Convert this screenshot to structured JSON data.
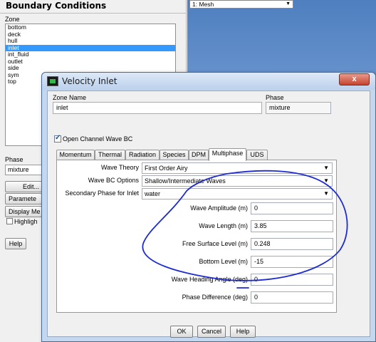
{
  "panel": {
    "title": "Boundary Conditions",
    "zone_label": "Zone",
    "zones": [
      "bottom",
      "deck",
      "hull",
      "inlet",
      "int_fluid",
      "outlet",
      "side",
      "sym",
      "top"
    ],
    "selected_zone_index": 3,
    "phase_label": "Phase",
    "phase_value": "mixture",
    "edit_button": "Edit...",
    "parameters_button": "Paramete",
    "display_mesh_button": "Display Me",
    "highlight_label": "Highligh",
    "help_button": "Help"
  },
  "mesh": {
    "combo_value": "1: Mesh",
    "background_color": "#7da5db"
  },
  "dialog": {
    "title": "Velocity Inlet",
    "close_glyph": "x",
    "zone_name_label": "Zone Name",
    "zone_name_value": "inlet",
    "phase_label": "Phase",
    "phase_value": "mixture",
    "open_channel_label": "Open Channel Wave BC",
    "open_channel_checked": true,
    "tabs": [
      "Momentum",
      "Thermal",
      "Radiation",
      "Species",
      "DPM",
      "Multiphase",
      "UDS"
    ],
    "active_tab_index": 5,
    "wave_theory_label": "Wave Theory",
    "wave_theory_value": "First Order Airy",
    "wave_bc_label": "Wave BC Options",
    "wave_bc_value": "Shallow/Intermediate Waves",
    "secondary_phase_label": "Secondary Phase for Inlet",
    "secondary_phase_value": "water",
    "params": [
      {
        "label": "Wave Amplitude (m)",
        "value": "0"
      },
      {
        "label": "Wave Length (m)",
        "value": "3.85"
      },
      {
        "label": "Free Surface Level (m)",
        "value": "0.248"
      },
      {
        "label": "Bottom Level (m)",
        "value": "-15"
      },
      {
        "label": "Wave Heading Angle (deg)",
        "value": "0"
      },
      {
        "label": "Phase Difference (deg)",
        "value": "0"
      }
    ],
    "ok_button": "OK",
    "cancel_button": "Cancel",
    "help_button": "Help",
    "annotation_color": "#1d2bd0",
    "dropdown_arrow": "▼"
  }
}
